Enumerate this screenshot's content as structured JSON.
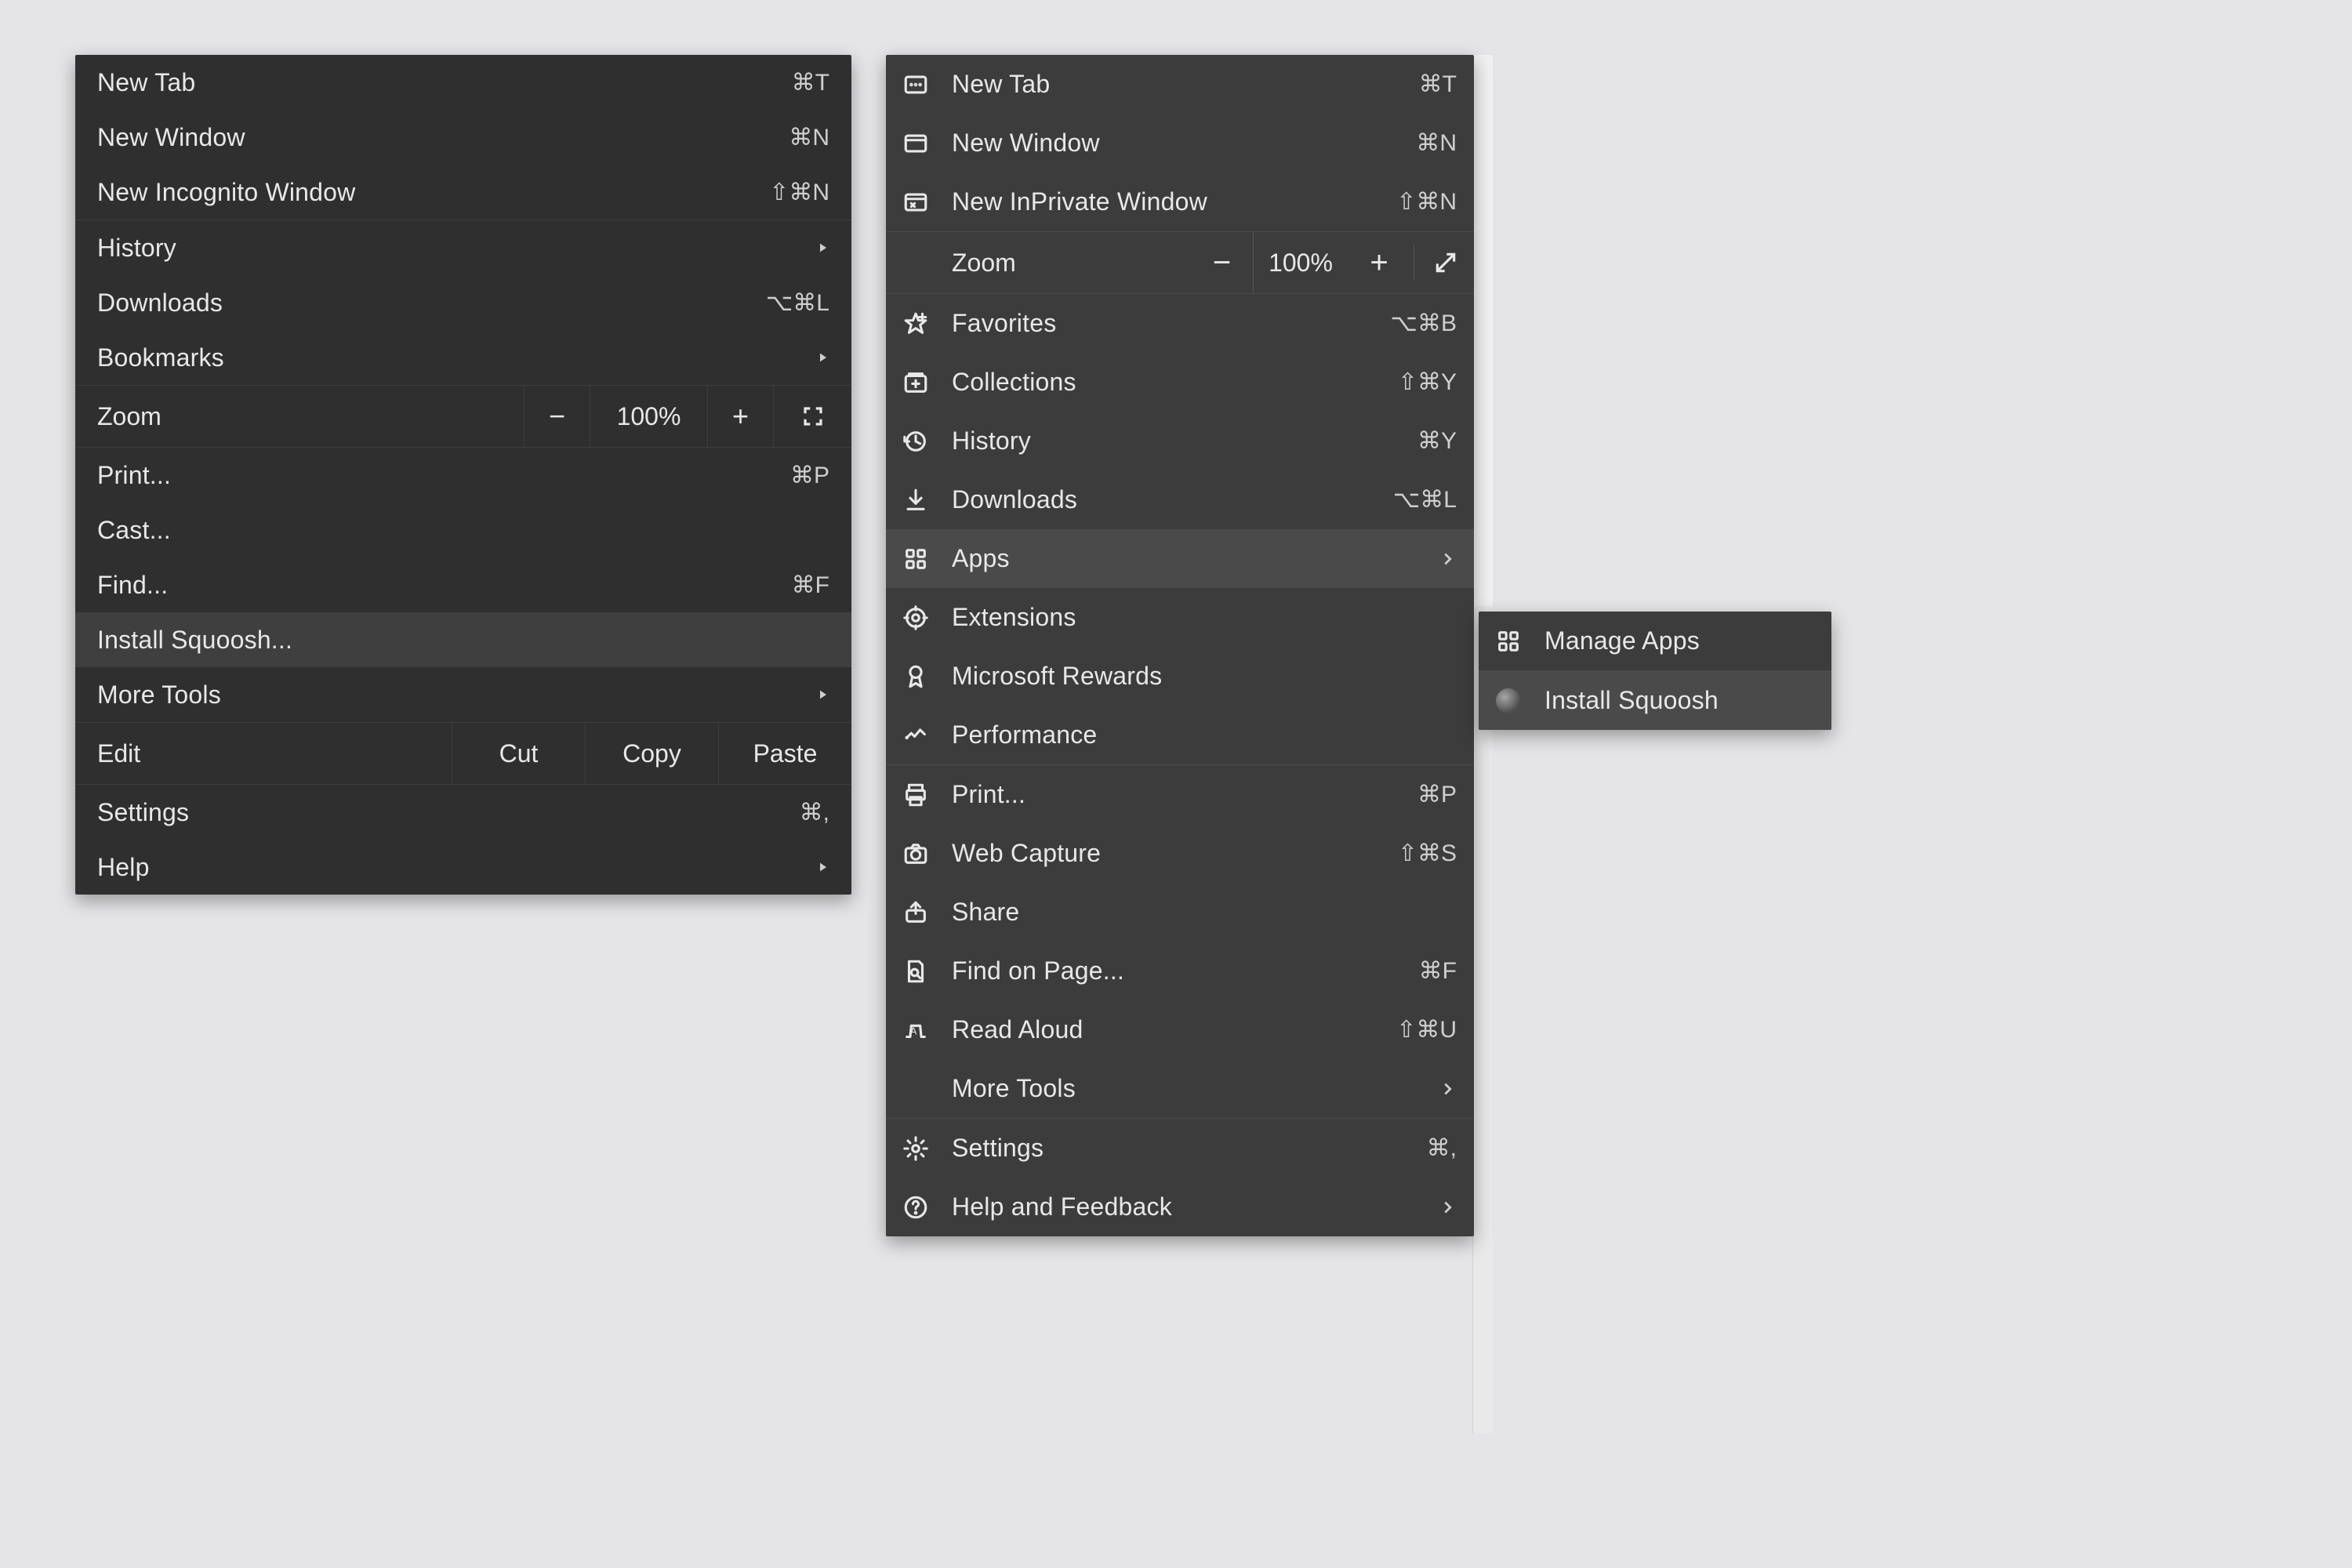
{
  "chrome": {
    "new_tab": {
      "label": "New Tab",
      "shortcut": "⌘T"
    },
    "new_window": {
      "label": "New Window",
      "shortcut": "⌘N"
    },
    "incognito": {
      "label": "New Incognito Window",
      "shortcut": "⇧⌘N"
    },
    "history": {
      "label": "History"
    },
    "downloads": {
      "label": "Downloads",
      "shortcut": "⌥⌘L"
    },
    "bookmarks": {
      "label": "Bookmarks"
    },
    "zoom": {
      "label": "Zoom",
      "value": "100%"
    },
    "print": {
      "label": "Print...",
      "shortcut": "⌘P"
    },
    "cast": {
      "label": "Cast..."
    },
    "find": {
      "label": "Find...",
      "shortcut": "⌘F"
    },
    "install": {
      "label": "Install Squoosh..."
    },
    "more_tools": {
      "label": "More Tools"
    },
    "edit": {
      "label": "Edit",
      "cut": "Cut",
      "copy": "Copy",
      "paste": "Paste"
    },
    "settings": {
      "label": "Settings",
      "shortcut": "⌘,"
    },
    "help": {
      "label": "Help"
    }
  },
  "edge": {
    "new_tab": {
      "label": "New Tab",
      "shortcut": "⌘T"
    },
    "new_window": {
      "label": "New Window",
      "shortcut": "⌘N"
    },
    "inprivate": {
      "label": "New InPrivate Window",
      "shortcut": "⇧⌘N"
    },
    "zoom": {
      "label": "Zoom",
      "value": "100%"
    },
    "favorites": {
      "label": "Favorites",
      "shortcut": "⌥⌘B"
    },
    "collections": {
      "label": "Collections",
      "shortcut": "⇧⌘Y"
    },
    "history": {
      "label": "History",
      "shortcut": "⌘Y"
    },
    "downloads": {
      "label": "Downloads",
      "shortcut": "⌥⌘L"
    },
    "apps": {
      "label": "Apps"
    },
    "extensions": {
      "label": "Extensions"
    },
    "rewards": {
      "label": "Microsoft Rewards"
    },
    "performance": {
      "label": "Performance"
    },
    "print": {
      "label": "Print...",
      "shortcut": "⌘P"
    },
    "webcapture": {
      "label": "Web Capture",
      "shortcut": "⇧⌘S"
    },
    "share": {
      "label": "Share"
    },
    "find": {
      "label": "Find on Page...",
      "shortcut": "⌘F"
    },
    "readaloud": {
      "label": "Read Aloud",
      "shortcut": "⇧⌘U"
    },
    "more_tools": {
      "label": "More Tools"
    },
    "settings": {
      "label": "Settings",
      "shortcut": "⌘,"
    },
    "help": {
      "label": "Help and Feedback"
    }
  },
  "submenu": {
    "manage": {
      "label": "Manage Apps"
    },
    "install": {
      "label": "Install Squoosh"
    }
  }
}
